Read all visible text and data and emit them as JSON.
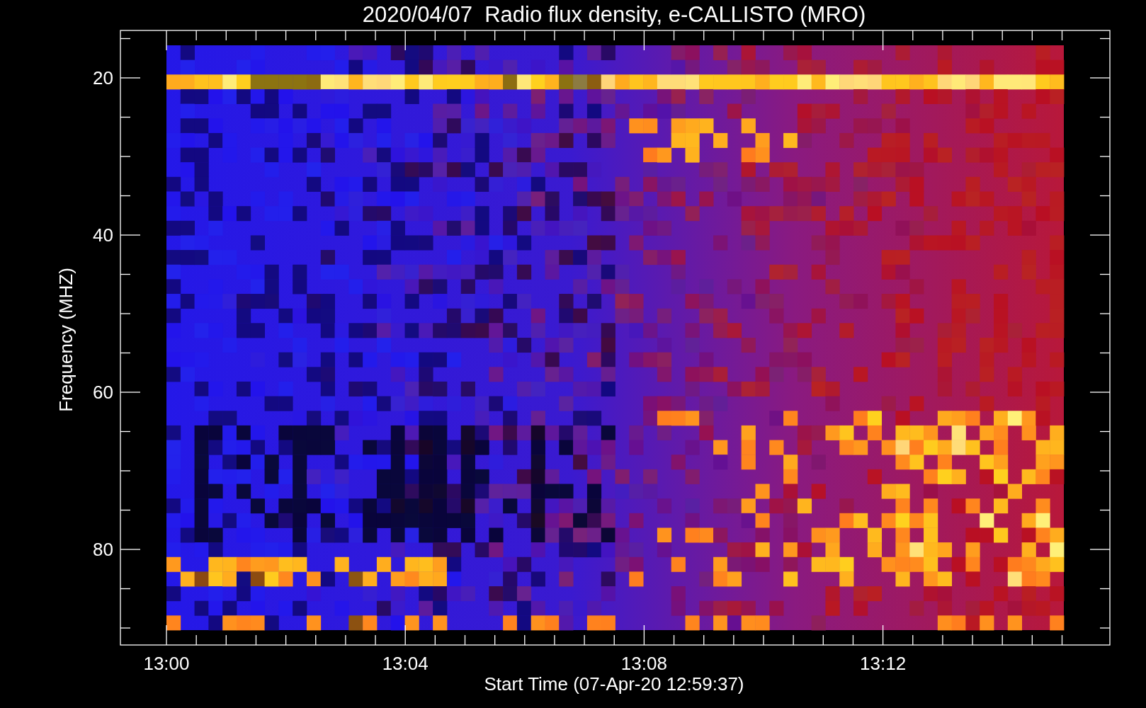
{
  "title": "2020/04/07  Radio flux density, e-CALLISTO (MRO)",
  "y_axis": {
    "label": "Frequency (MHZ)",
    "ticks": [
      "20",
      "40",
      "60",
      "80"
    ]
  },
  "x_axis": {
    "label": "Start Time (07-Apr-20 12:59:37)",
    "ticks": [
      "13:00",
      "13:04",
      "13:08",
      "13:12"
    ]
  }
}
